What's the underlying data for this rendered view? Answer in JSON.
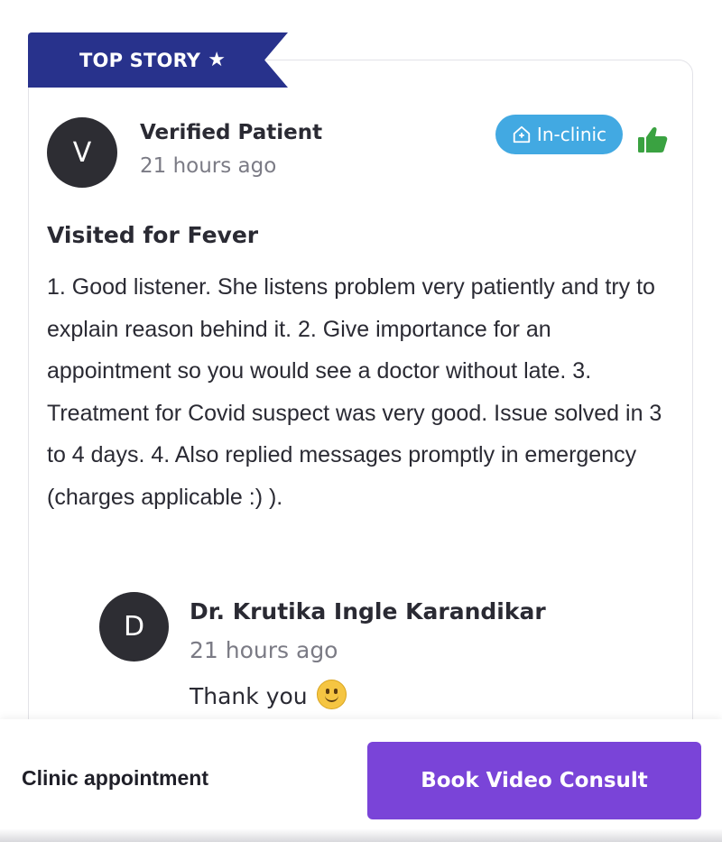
{
  "ribbon": {
    "label": "TOP STORY",
    "icon": "star-icon"
  },
  "review": {
    "avatar_letter": "V",
    "author": "Verified Patient",
    "time": "21 hours ago",
    "badge": {
      "label": "In-clinic",
      "icon": "clinic-home-icon",
      "color": "#42a9e2"
    },
    "like_icon": "thumbs-up-icon",
    "like_color": "#3aa241",
    "visited_for": "Visited for Fever",
    "text": "1. Good listener. She listens problem very patiently and try to explain reason behind it. 2. Give importance for an appointment so you would see a doctor without late. 3. Treatment for Covid suspect was very good. Issue solved in 3 to 4 days. 4. Also replied messages promptly in emergency (charges applicable :) )."
  },
  "reply": {
    "avatar_letter": "D",
    "author": "Dr. Krutika Ingle Karandikar",
    "time": "21 hours ago",
    "text": "Thank you",
    "emoji": "smiley-icon"
  },
  "footer": {
    "clinic_label": "Clinic appointment",
    "book_label": "Book Video Consult",
    "book_color": "#7a44d8"
  },
  "colors": {
    "ribbon": "#28328c",
    "avatar": "#2d2d33"
  }
}
